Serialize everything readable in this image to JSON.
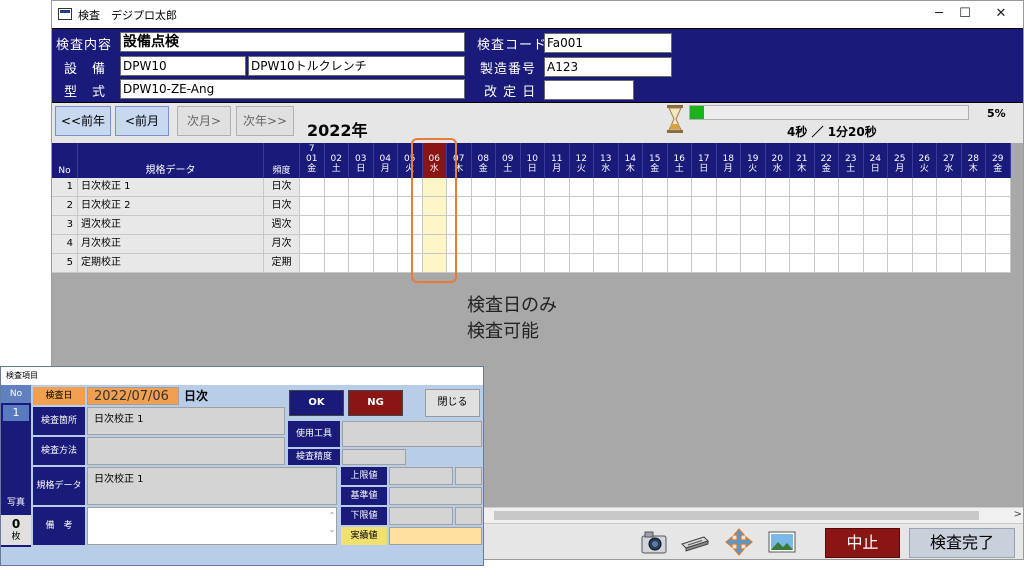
{
  "window": {
    "title": "検査　デジプロ太郎",
    "minimize": "─",
    "maximize": "☐",
    "close": "✕"
  },
  "header": {
    "inspection_content_label": "検査内容",
    "inspection_content_value": "設備点検",
    "inspection_code_label": "検査コード",
    "inspection_code_value": "Fa001",
    "equipment_label": "設　備",
    "equipment_code": "DPW10",
    "equipment_name": "DPW10トルクレンチ",
    "serial_label": "製造番号",
    "serial_value": "A123",
    "model_label": "型　式",
    "model_value": "DPW10-ZE-Ang",
    "revision_label": "改 定 日",
    "revision_value": ""
  },
  "nav": {
    "prev_year": "<<前年",
    "prev_month": "<前月",
    "next_month": "次月>",
    "next_year": "次年>>",
    "year": "2022年"
  },
  "progress": {
    "value": 0.05,
    "percent": "5%",
    "time_text": "4秒 ／ 1分20秒"
  },
  "grid": {
    "head_no": "No",
    "head_spec": "規格データ",
    "head_freq": "頻度",
    "days": [
      {
        "top": "7",
        "day": "01",
        "wd": "金"
      },
      {
        "day": "02",
        "wd": "土"
      },
      {
        "day": "03",
        "wd": "日"
      },
      {
        "day": "04",
        "wd": "月"
      },
      {
        "day": "05",
        "wd": "火"
      },
      {
        "day": "06",
        "wd": "水"
      },
      {
        "day": "07",
        "wd": "木"
      },
      {
        "day": "08",
        "wd": "金"
      },
      {
        "day": "09",
        "wd": "土"
      },
      {
        "day": "10",
        "wd": "日"
      },
      {
        "day": "11",
        "wd": "月"
      },
      {
        "day": "12",
        "wd": "火"
      },
      {
        "day": "13",
        "wd": "水"
      },
      {
        "day": "14",
        "wd": "木"
      },
      {
        "day": "15",
        "wd": "金"
      },
      {
        "day": "16",
        "wd": "土"
      },
      {
        "day": "17",
        "wd": "日"
      },
      {
        "day": "18",
        "wd": "月"
      },
      {
        "day": "19",
        "wd": "火"
      },
      {
        "day": "20",
        "wd": "水"
      },
      {
        "day": "21",
        "wd": "木"
      },
      {
        "day": "22",
        "wd": "金"
      },
      {
        "day": "23",
        "wd": "土"
      },
      {
        "day": "24",
        "wd": "日"
      },
      {
        "day": "25",
        "wd": "月"
      },
      {
        "day": "26",
        "wd": "火"
      },
      {
        "day": "27",
        "wd": "水"
      },
      {
        "day": "28",
        "wd": "木"
      },
      {
        "day": "29",
        "wd": "金"
      }
    ],
    "selected_day_index": 5,
    "rows": [
      {
        "no": "1",
        "name": "日次校正 1",
        "freq": "日次"
      },
      {
        "no": "2",
        "name": "日次校正 2",
        "freq": "日次"
      },
      {
        "no": "3",
        "name": "週次校正",
        "freq": "週次"
      },
      {
        "no": "4",
        "name": "月次校正",
        "freq": "月次"
      },
      {
        "no": "5",
        "name": "定期校正",
        "freq": "定期"
      }
    ]
  },
  "annotation": {
    "line1": "検査日のみ",
    "line2": "検査可能"
  },
  "bottom": {
    "stop_label": "中止",
    "complete_label": "検査完了"
  },
  "dialog": {
    "title": "検査項目",
    "no_label": "No",
    "no_value": "1",
    "photo_label": "写真",
    "photo_count": "0",
    "photo_unit": "枚",
    "date_label": "検査日",
    "date_value": "2022/07/06",
    "weekday": "日次",
    "location_label": "検査箇所",
    "location_value": "日次校正 1",
    "method_label": "検査方法",
    "method_value": "",
    "spec_label": "規格データ",
    "spec_value": "日次校正 1",
    "remark_label": "備　考",
    "remark_value": "",
    "ok_label": "OK",
    "ng_label": "NG",
    "close_label": "閉じる",
    "tool_label": "使用工具",
    "tool_value": "",
    "precision_label": "検査精度",
    "precision_value": "",
    "upper_label": "上限値",
    "standard_label": "基準値",
    "lower_label": "下限値",
    "actual_label": "実績値"
  },
  "colors": {
    "header_navy": "#1a1a7a",
    "selected_day": "#8a1515",
    "selected_cell": "#fff6c8",
    "progress": "#18b418",
    "highlight": "#e87c38"
  }
}
